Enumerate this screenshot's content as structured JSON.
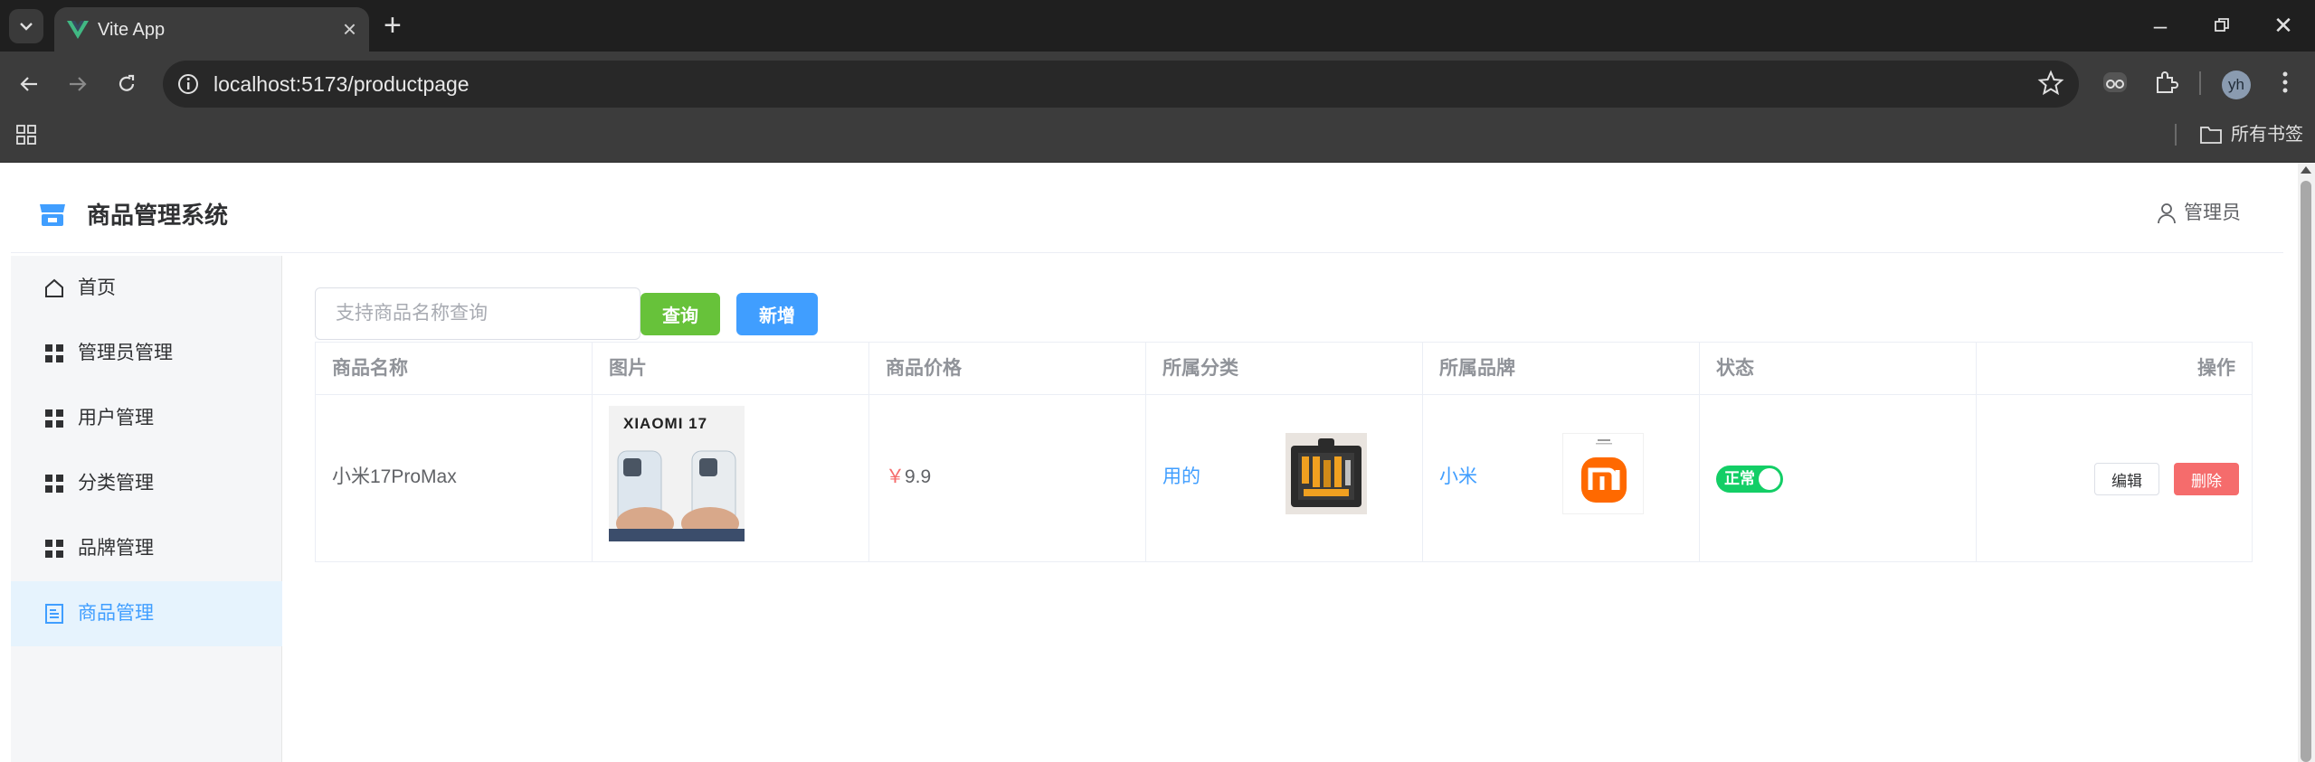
{
  "browser": {
    "tab_title": "Vite App",
    "url": "localhost:5173/productpage",
    "profile_initials": "yh",
    "bookmarks_folder": "所有书签"
  },
  "header": {
    "app_title": "商品管理系统",
    "user": "管理员"
  },
  "sidebar": {
    "items": [
      {
        "label": "首页",
        "icon": "home-icon"
      },
      {
        "label": "管理员管理",
        "icon": "grid-icon"
      },
      {
        "label": "用户管理",
        "icon": "grid-icon"
      },
      {
        "label": "分类管理",
        "icon": "grid-icon"
      },
      {
        "label": "品牌管理",
        "icon": "grid-icon"
      },
      {
        "label": "商品管理",
        "icon": "document-icon",
        "active": true
      }
    ]
  },
  "toolbar": {
    "search_placeholder": "支持商品名称查询",
    "query_label": "查询",
    "add_label": "新增"
  },
  "table": {
    "columns": [
      "商品名称",
      "图片",
      "商品价格",
      "所属分类",
      "所属品牌",
      "状态",
      "操作"
    ],
    "rows": [
      {
        "name": "小米17ProMax",
        "image_text": "XIAOMI 17",
        "price_symbol": "￥",
        "price": "9.9",
        "category": "用的",
        "brand": "小米",
        "status": "正常",
        "edit_label": "编辑",
        "delete_label": "删除"
      }
    ]
  },
  "colors": {
    "primary": "#409eff",
    "success": "#67c23a",
    "danger": "#f56c6c",
    "switch_on": "#13ce66"
  }
}
